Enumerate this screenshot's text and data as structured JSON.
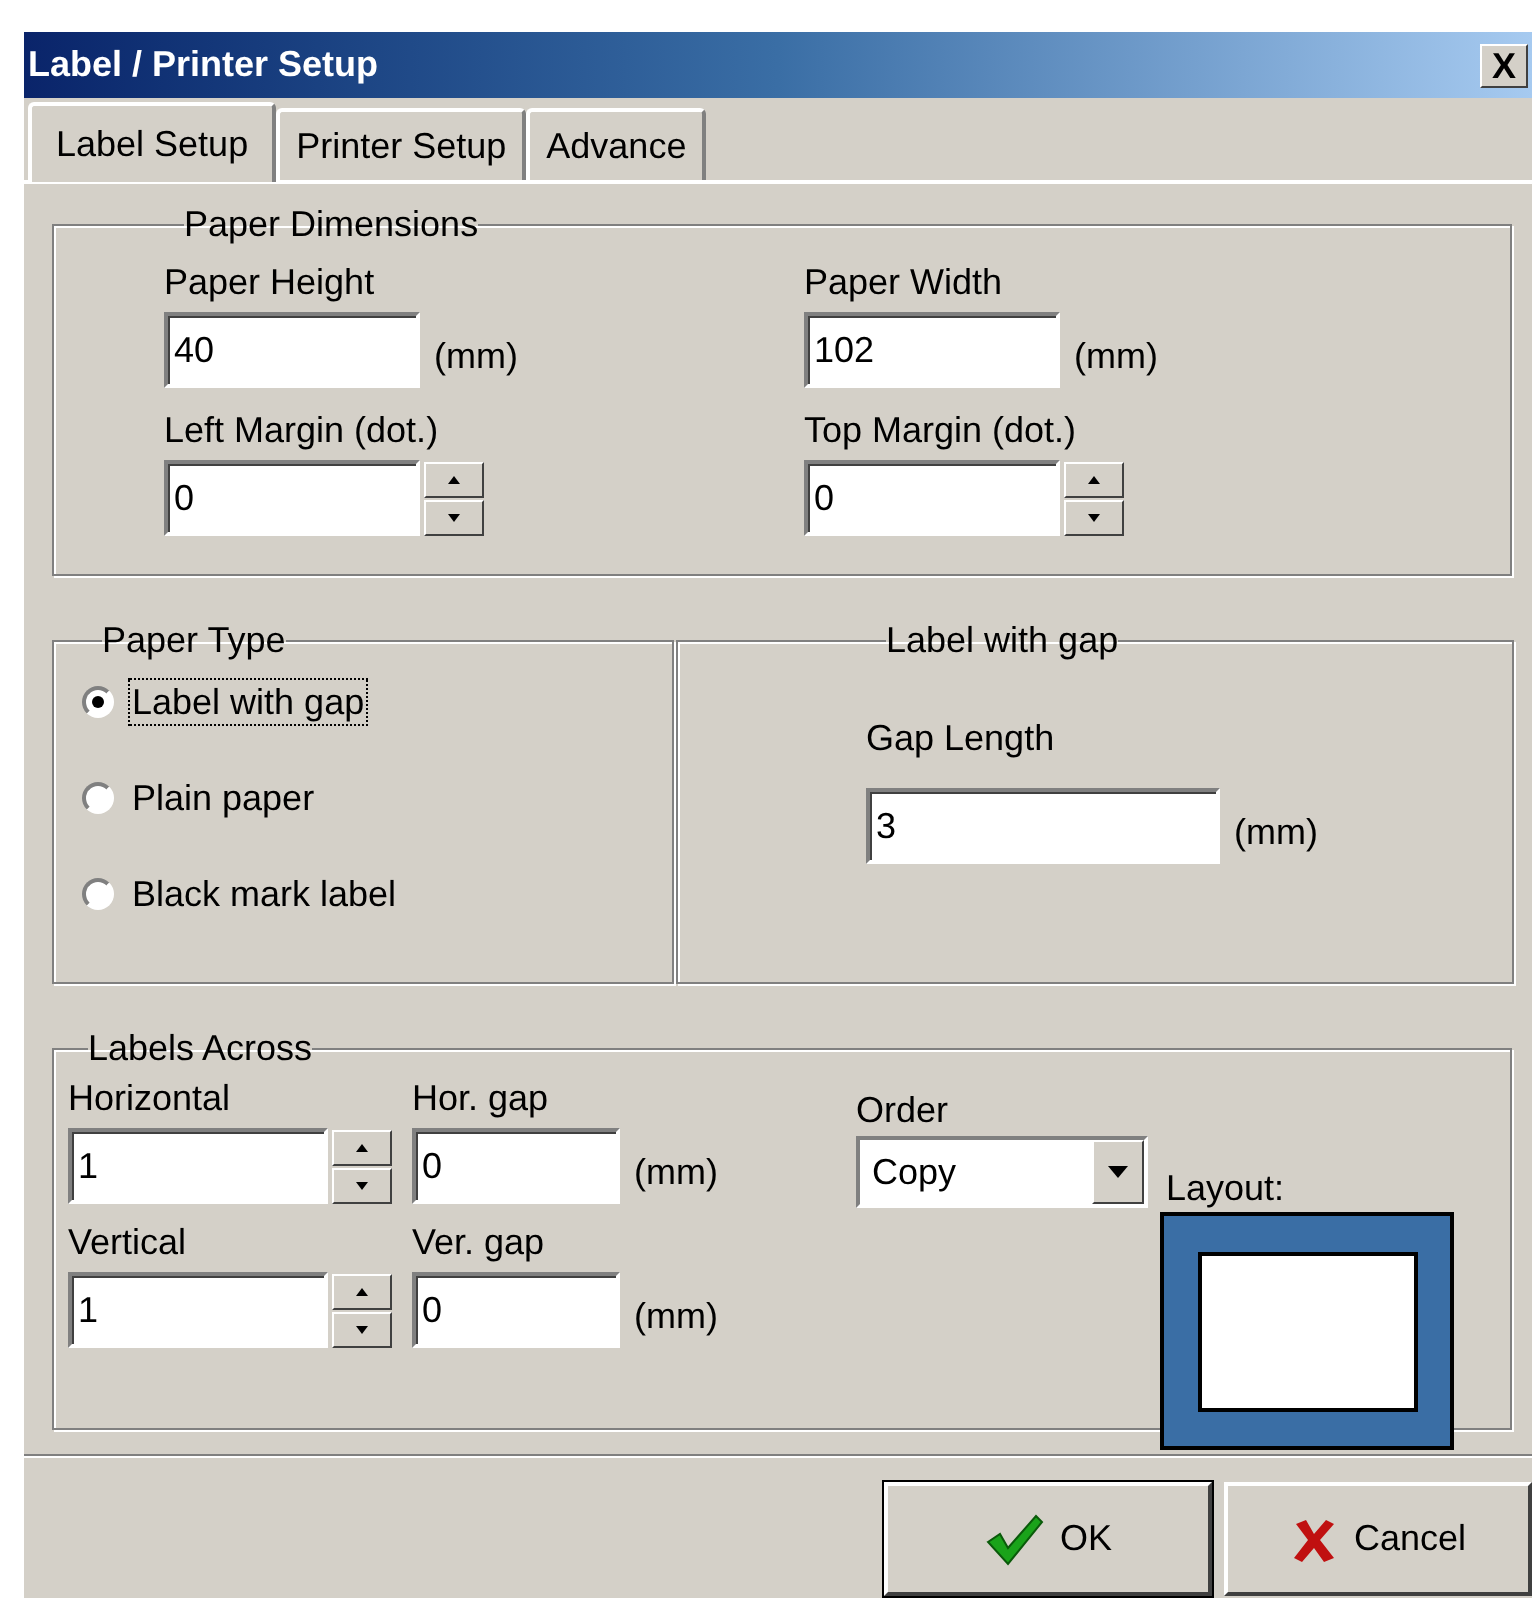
{
  "window": {
    "title": "Label / Printer Setup",
    "close": "X"
  },
  "tabs": [
    {
      "label": "Label Setup",
      "selected": true
    },
    {
      "label": "Printer Setup",
      "selected": false
    },
    {
      "label": "Advance",
      "selected": false
    }
  ],
  "paper_dimensions": {
    "title": "Paper Dimensions",
    "fields": [
      {
        "kind": "text",
        "label": "Paper Height",
        "value": "40",
        "unit": "(mm)"
      },
      {
        "kind": "text",
        "label": "Paper Width",
        "value": "102",
        "unit": "(mm)"
      },
      {
        "kind": "spin",
        "label": "Left Margin (dot.)",
        "value": "0"
      },
      {
        "kind": "spin",
        "label": "Top Margin (dot.)",
        "value": "0"
      }
    ]
  },
  "paper_type": {
    "title": "Paper Type",
    "options": [
      {
        "label": "Label with gap",
        "selected": true
      },
      {
        "label": "Plain paper",
        "selected": false
      },
      {
        "label": "Black mark label",
        "selected": false
      }
    ]
  },
  "gap_group": {
    "title": "Label with gap",
    "label": "Gap Length",
    "value": "3",
    "unit": "(mm)"
  },
  "labels_across": {
    "title": "Labels Across",
    "fields": [
      {
        "kind": "spin",
        "label": "Horizontal",
        "value": "1"
      },
      {
        "kind": "text",
        "label": "Hor. gap",
        "value": "0",
        "unit": "(mm)"
      },
      {
        "kind": "spin",
        "label": "Vertical",
        "value": "1"
      },
      {
        "kind": "text",
        "label": "Ver. gap",
        "value": "0",
        "unit": "(mm)"
      }
    ],
    "order": {
      "label": "Order",
      "value": "Copy"
    },
    "layout": {
      "label": "Layout:"
    }
  },
  "buttons": [
    {
      "kind": "ok",
      "label": "OK"
    },
    {
      "kind": "cancel",
      "label": "Cancel"
    }
  ]
}
